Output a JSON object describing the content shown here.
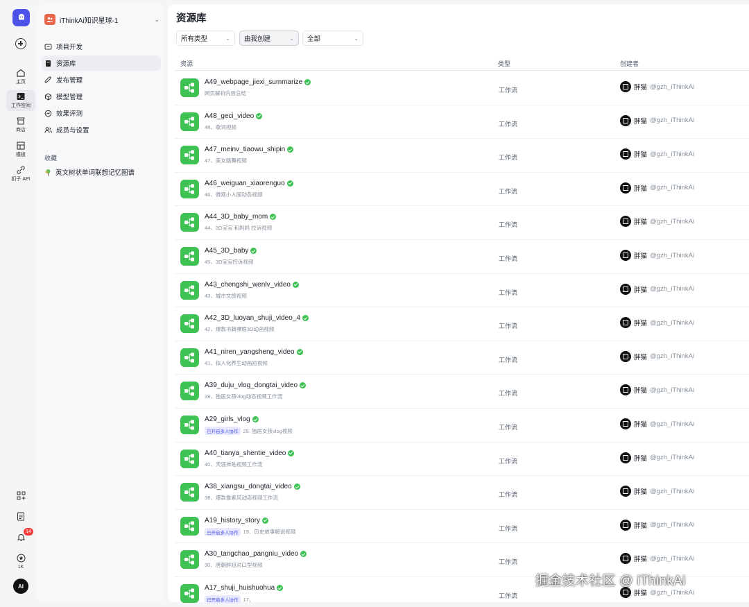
{
  "rail": {
    "items": [
      {
        "label": "主页",
        "icon": "home-icon"
      },
      {
        "label": "工作空间",
        "icon": "terminal-icon",
        "active": true
      },
      {
        "label": "商店",
        "icon": "store-icon"
      },
      {
        "label": "模板",
        "icon": "template-icon"
      },
      {
        "label": "扣子 API",
        "icon": "api-icon"
      }
    ],
    "notification_count": "14",
    "star_count": "1K",
    "avatar_text": "AI"
  },
  "sidebar": {
    "space_name": "iThinkAi知识星球-1",
    "nav": [
      {
        "label": "项目开发",
        "icon": "project-icon"
      },
      {
        "label": "资源库",
        "icon": "library-icon",
        "active": true
      },
      {
        "label": "发布管理",
        "icon": "rocket-icon"
      },
      {
        "label": "模型管理",
        "icon": "model-icon"
      },
      {
        "label": "效果评测",
        "icon": "evaluate-icon"
      },
      {
        "label": "成员与设置",
        "icon": "members-icon"
      }
    ],
    "favorites_title": "收藏",
    "favorites": [
      {
        "label": "英文树状单词联想记忆图谱"
      }
    ]
  },
  "main": {
    "title": "资源库",
    "filters": [
      {
        "label": "所有类型"
      },
      {
        "label": "由我创建"
      },
      {
        "label": "全部"
      }
    ],
    "columns": {
      "resource": "资源",
      "type": "类型",
      "creator": "创建者"
    },
    "rows": [
      {
        "name": "A49_webpage_jiexi_summarize",
        "desc": "网页解析内容总结",
        "tag": "",
        "type": "工作流",
        "creator": "胖猫",
        "handle": "@gzh_iThinkAi"
      },
      {
        "name": "A48_geci_video",
        "desc": "48、歌词视频",
        "tag": "",
        "type": "工作流",
        "creator": "胖猫",
        "handle": "@gzh_iThinkAi"
      },
      {
        "name": "A47_meinv_tiaowu_shipin",
        "desc": "47、美女跳舞视频",
        "tag": "",
        "type": "工作流",
        "creator": "胖猫",
        "handle": "@gzh_iThinkAi"
      },
      {
        "name": "A46_weiguan_xiaorenguo",
        "desc": "46、微观小人国动态视频",
        "tag": "",
        "type": "工作流",
        "creator": "胖猫",
        "handle": "@gzh_iThinkAi"
      },
      {
        "name": "A44_3D_baby_mom",
        "desc": "44、3D宝宝 和妈妈 拉诉视频",
        "tag": "",
        "type": "工作流",
        "creator": "胖猫",
        "handle": "@gzh_iThinkAi"
      },
      {
        "name": "A45_3D_baby",
        "desc": "45、3D宝宝控诉视频",
        "tag": "",
        "type": "工作流",
        "creator": "胖猫",
        "handle": "@gzh_iThinkAi"
      },
      {
        "name": "A43_chengshi_wenlv_video",
        "desc": "43、城市文旅视频",
        "tag": "",
        "type": "工作流",
        "creator": "胖猫",
        "handle": "@gzh_iThinkAi"
      },
      {
        "name": "A42_3D_luoyan_shuji_video_4",
        "desc": "42、爆款书籍裸眼3D动画视频",
        "tag": "",
        "type": "工作流",
        "creator": "胖猫",
        "handle": "@gzh_iThinkAi"
      },
      {
        "name": "A41_niren_yangsheng_video",
        "desc": "41、拟人化养生动画短视频",
        "tag": "",
        "type": "工作流",
        "creator": "胖猫",
        "handle": "@gzh_iThinkAi"
      },
      {
        "name": "A39_duju_vlog_dongtai_video",
        "desc": "39、独居女孩vlog动态视频工作流",
        "tag": "",
        "type": "工作流",
        "creator": "胖猫",
        "handle": "@gzh_iThinkAi"
      },
      {
        "name": "A29_girls_vlog",
        "desc": "29. 独居女孩vlog视频",
        "tag": "已开启多人协作",
        "type": "工作流",
        "creator": "胖猫",
        "handle": "@gzh_iThinkAi"
      },
      {
        "name": "A40_tianya_shentie_video",
        "desc": "40、天涯神贴视频工作流",
        "tag": "",
        "type": "工作流",
        "creator": "胖猫",
        "handle": "@gzh_iThinkAi"
      },
      {
        "name": "A38_xiangsu_dongtai_video",
        "desc": "38、爆款像素风动态视频工作流",
        "tag": "",
        "type": "工作流",
        "creator": "胖猫",
        "handle": "@gzh_iThinkAi"
      },
      {
        "name": "A19_history_story",
        "desc": "19、历史故事解说视频",
        "tag": "已开启多人协作",
        "type": "工作流",
        "creator": "胖猫",
        "handle": "@gzh_iThinkAi"
      },
      {
        "name": "A30_tangchao_pangniu_video",
        "desc": "30、唐朝胖妞对口型视频",
        "tag": "",
        "type": "工作流",
        "creator": "胖猫",
        "handle": "@gzh_iThinkAi"
      },
      {
        "name": "A17_shuji_huishuohua",
        "desc": "17、",
        "tag": "已开启多人协作",
        "type": "工作流",
        "creator": "胖猫",
        "handle": "@gzh_iThinkAi"
      }
    ]
  },
  "watermark": "掘金技术社区 @ iThinkAi",
  "colors": {
    "accent": "#4d53e8",
    "workflow_green": "#3ec254",
    "badge_red": "#f53f3f"
  }
}
